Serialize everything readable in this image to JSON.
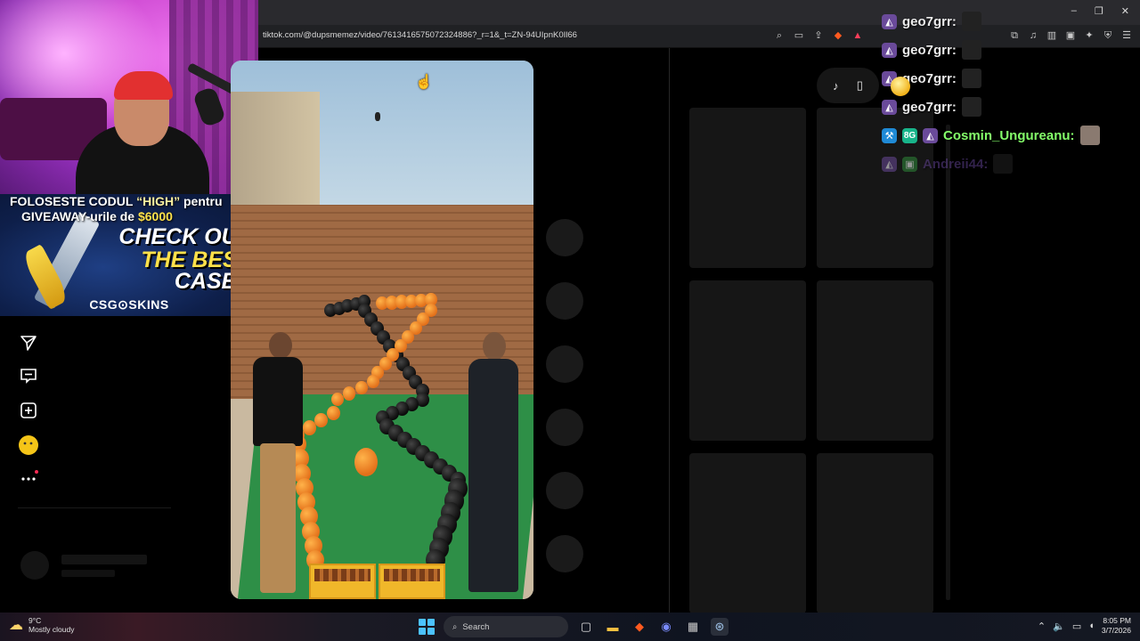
{
  "browser": {
    "url": "tiktok.com/@dupsmemez/video/7613416575072324886?_r=1&_t=ZN-94UIpnK0Il66",
    "window_controls": [
      "–",
      "❐",
      "✕"
    ]
  },
  "ad": {
    "line1_pre": "FOLOSESTE CODUL",
    "line1_code": "“HIGH”",
    "line1_post": "pentru",
    "line2_pre": "GIVEAWAY-urile de",
    "line2_amount": "$6000",
    "check": "CHECK OUT",
    "best": "THE BEST",
    "cases": "CASES",
    "brand": "CSG⊙SKINS"
  },
  "sidebar": {
    "icons": [
      "send-icon",
      "inbox-icon",
      "add-icon",
      "profile-emoji-icon",
      "more-icon"
    ]
  },
  "chat": {
    "messages": [
      {
        "user": "geo7grr:",
        "style": "normal"
      },
      {
        "user": "geo7grr:",
        "style": "normal"
      },
      {
        "user": "geo7grr:",
        "style": "normal"
      },
      {
        "user": "geo7grr:",
        "style": "normal"
      },
      {
        "user": "Cosmin_Ungureanu:",
        "style": "green"
      },
      {
        "user": "Andreii44:",
        "style": "faded"
      }
    ],
    "badge_text": "8G"
  },
  "taskbar": {
    "temperature": "9°C",
    "weather": "Mostly cloudy",
    "search_placeholder": "Search",
    "time": "8:05 PM",
    "date": "3/7/2026"
  },
  "colors": {
    "accent_green": "#84ff6a",
    "ad_yellow": "#ffe14a",
    "tiktok_bg": "#000000"
  }
}
